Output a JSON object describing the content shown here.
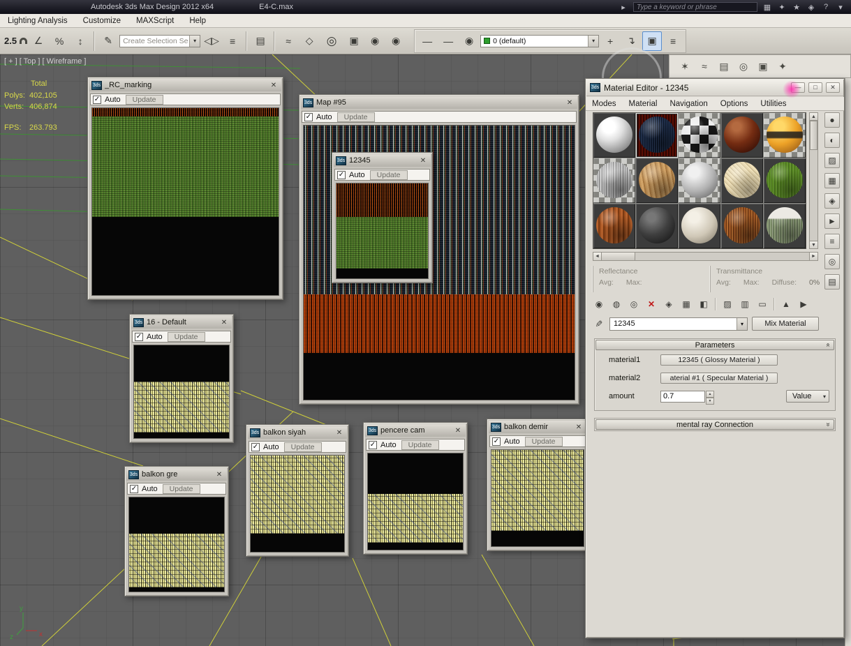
{
  "titlebar": {
    "app_title": "Autodesk 3ds Max Design 2012 x64",
    "file_name": "E4-C.max",
    "search_placeholder": "Type a keyword or phrase",
    "icons": {
      "go": "▸",
      "communication": "▦",
      "key": "✦",
      "favorites": "★",
      "pin": "◈",
      "help": "?",
      "arrow": "▾"
    }
  },
  "menubar": {
    "items": [
      "Lighting Analysis",
      "Customize",
      "MAXScript",
      "Help"
    ]
  },
  "main_toolbar": {
    "snap_value": "2.5",
    "selection_combo": "Create Selection Se",
    "layer_combo": "0 (default)",
    "icons": {
      "angle_snap": "∠",
      "percent_snap": "%",
      "spinner_snap": "↕",
      "named_sets": "✎",
      "mirror": "◁▷",
      "align": "≡",
      "layer_manager": "▤",
      "curve_editor": "≈",
      "schematic_view": "◇",
      "render_setup": "◎",
      "render_frame": "▣",
      "teapot": "◉",
      "line": "—",
      "eye": "◉",
      "new_layer": "+",
      "add_to_layer": "↴",
      "select_in_layer": "▣",
      "layer_props": "≡"
    }
  },
  "command_panel": {
    "icons": {
      "create": "✶",
      "modify": "≈",
      "hierarchy": "▤",
      "motion": "◎",
      "display": "▣",
      "utilities": "✦"
    }
  },
  "viewport": {
    "label": "[ + ] [ Top ] [ Wireframe ]",
    "stats": {
      "total": "Total",
      "polys_label": "Polys:",
      "polys_value": "402,105",
      "verts_label": "Verts:",
      "verts_value": "406,874",
      "fps_label": "FPS:",
      "fps_value": "263.793"
    },
    "axis": {
      "x": "x",
      "y": "y",
      "z": "z"
    }
  },
  "preview_windows": [
    {
      "title": "_RC_marking",
      "auto": "Auto",
      "update": "Update"
    },
    {
      "title": "Map #95",
      "auto": "Auto",
      "update": "Update"
    },
    {
      "title": "12345",
      "auto": "Auto",
      "update": "Update"
    },
    {
      "title": "16 - Default",
      "auto": "Auto",
      "update": "Update"
    },
    {
      "title": "balkon gre",
      "auto": "Auto",
      "update": "Update"
    },
    {
      "title": "balkon siyah",
      "auto": "Auto",
      "update": "Update"
    },
    {
      "title": "pencere cam",
      "auto": "Auto",
      "update": "Update"
    },
    {
      "title": "balkon demir",
      "auto": "Auto",
      "update": "Update"
    }
  ],
  "material_editor": {
    "title": "Material Editor - 12345",
    "menus": [
      "Modes",
      "Material",
      "Navigation",
      "Options",
      "Utilities"
    ],
    "reflectance": {
      "title": "Reflectance",
      "avg": "Avg:",
      "max": "Max:"
    },
    "transmittance": {
      "title": "Transmittance",
      "avg": "Avg:",
      "max": "Max:",
      "diffuse": "Diffuse:",
      "diffuse_value": "0%"
    },
    "picker_icon": "✎",
    "material_name": "12345",
    "type_button": "Mix Material",
    "side_icons": {
      "sample_type": "●",
      "backlight": "◐",
      "background": "▨",
      "tiling": "▦",
      "video_check": "◈",
      "preview": "►",
      "options": "≡",
      "select_by_material": "◎",
      "navigator": "▤"
    },
    "tool_icons": {
      "get": "◉",
      "put": "◍",
      "assign": "◎",
      "reset": "✕",
      "copy": "◈",
      "library": "▦",
      "id": "◧",
      "background": "▨",
      "show_map": "▥",
      "end_result": "▭",
      "parent": "▲",
      "forward": "▶"
    },
    "parameters": {
      "header": "Parameters",
      "material1_label": "material1",
      "material1_value": "12345  ( Glossy Material )",
      "material2_label": "material2",
      "material2_value": "aterial #1  ( Specular Material )",
      "amount_label": "amount",
      "amount_value": "0.7",
      "amount_mode": "Value"
    },
    "mental_ray_header": "mental ray Connection"
  },
  "glyphs": {
    "close": "✕",
    "check": "✓",
    "dropdown": "▾",
    "left": "◄",
    "right": "►",
    "up": "▲",
    "down": "▼",
    "chev_open": "«",
    "chev_closed": "»",
    "minimize": "—",
    "maximize": "□",
    "map_icon": "3ds"
  },
  "colors": {
    "wire_yellow": "#cfcf3a",
    "wire_green": "#3f8f36",
    "stats_yellow": "#d8d84a",
    "selected_slot": "#5a0e04",
    "highlight_pink": "#ff2fae"
  }
}
